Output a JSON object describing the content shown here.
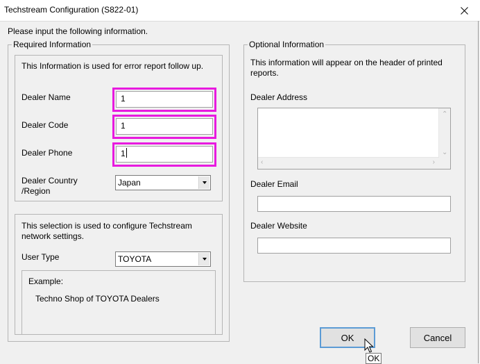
{
  "window": {
    "title": "Techstream Configuration (S822-01)"
  },
  "intro": "Please input the following information.",
  "required": {
    "legend": "Required Information",
    "note": "This Information is used for error report follow up.",
    "dealer_name": {
      "label": "Dealer Name",
      "value": "1"
    },
    "dealer_code": {
      "label": "Dealer Code",
      "value": "1"
    },
    "dealer_phone": {
      "label": "Dealer Phone",
      "value": "1"
    },
    "dealer_country": {
      "label_line1": "Dealer Country",
      "label_line2": "/Region",
      "value": "Japan"
    }
  },
  "network": {
    "note": "This selection is used to configure Techstream network settings.",
    "user_type": {
      "label": "User Type",
      "value": "TOYOTA"
    },
    "example": {
      "legend": "Example:",
      "text": "Techno Shop of TOYOTA Dealers"
    }
  },
  "optional": {
    "legend": "Optional Information",
    "note": "This information will appear on the header of printed reports.",
    "dealer_address": {
      "label": "Dealer Address",
      "value": ""
    },
    "dealer_email": {
      "label": "Dealer Email",
      "value": ""
    },
    "dealer_website": {
      "label": "Dealer Website",
      "value": ""
    }
  },
  "buttons": {
    "ok": "OK",
    "cancel": "Cancel"
  },
  "tooltip": "OK",
  "icons": {
    "close": "close-icon",
    "dropdown": "chevron-down-icon",
    "cursor": "mouse-pointer-icon"
  },
  "colors": {
    "highlight": "#e81adf",
    "default_button_border": "#5b9bd5"
  }
}
